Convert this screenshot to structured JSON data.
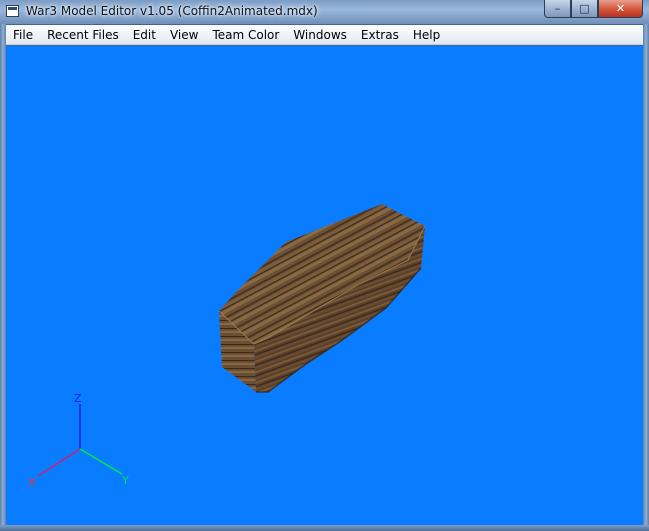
{
  "window": {
    "title": "War3 Model Editor v1.05 (Coffin2Animated.mdx)",
    "icon": "app-window-icon",
    "buttons": {
      "minimize": "–",
      "maximize": "□",
      "close": "✕"
    }
  },
  "menubar": {
    "items": [
      {
        "label": "File"
      },
      {
        "label": "Recent Files"
      },
      {
        "label": "Edit"
      },
      {
        "label": "View"
      },
      {
        "label": "Team Color"
      },
      {
        "label": "Windows"
      },
      {
        "label": "Extras"
      },
      {
        "label": "Help"
      }
    ]
  },
  "viewport": {
    "background": "#0a7cff",
    "model": "coffin-model",
    "axis_gizmo": {
      "x_label": "X",
      "y_label": "Y",
      "z_label": "Z",
      "x_color": "#ff2a2a",
      "y_color": "#00e64d",
      "z_color": "#1a1aff"
    }
  }
}
